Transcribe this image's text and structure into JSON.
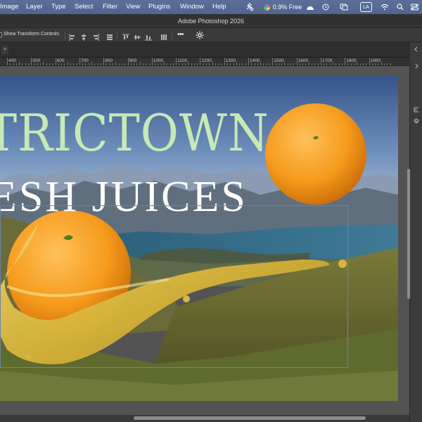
{
  "menubar": {
    "items": [
      "Image",
      "Layer",
      "Type",
      "Select",
      "Filter",
      "View",
      "Plugins",
      "Window",
      "Help"
    ],
    "storage_text": "0.9% Free",
    "user_badge": "LA"
  },
  "window": {
    "title": "Adobe Photoshop 2026"
  },
  "options_bar": {
    "transform_label": "Show Transform Controls",
    "more_label": "•••"
  },
  "tab": {
    "close_glyph": "×"
  },
  "ruler": {
    "labels": [
      "400",
      "500",
      "600",
      "700",
      "800",
      "900",
      "1000",
      "1100",
      "1200",
      "1300",
      "1400",
      "1500",
      "1600",
      "1700",
      "1800",
      "1900"
    ]
  },
  "canvas": {
    "headline_1": "TRICTOWN",
    "headline_2": "ESH JUICES"
  },
  "colors": {
    "menubar": "#55699a",
    "panel": "#3a3a3a",
    "canvas_bg": "#535353",
    "headline_1": "#c8e9b6",
    "headline_2": "#ffffff",
    "selection": "#6c84a8"
  }
}
